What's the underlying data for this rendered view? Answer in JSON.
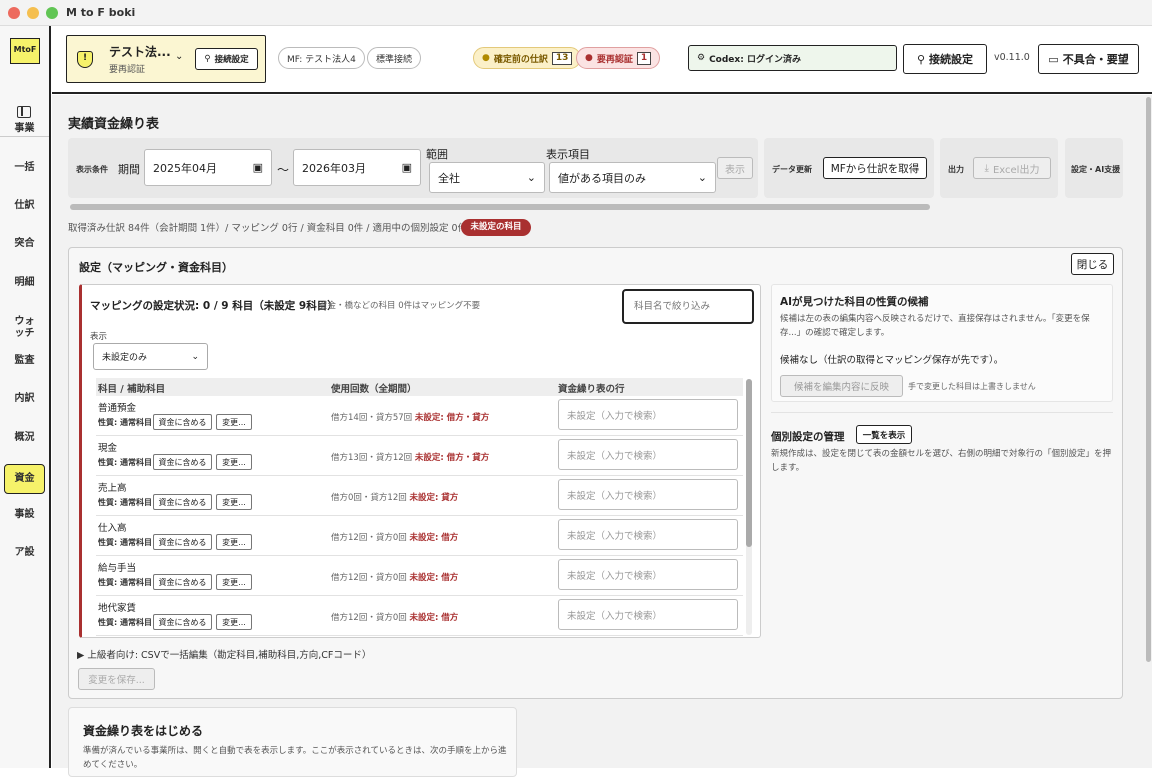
{
  "window": {
    "title": "M to F boki"
  },
  "sidebar": {
    "logo": "MtoF",
    "items": [
      "事業",
      "一括",
      "仕訳",
      "突合",
      "明細",
      "ウォッチ",
      "監査",
      "内訳",
      "概況",
      "資金",
      "事設",
      "ア設"
    ],
    "active": "資金"
  },
  "topbar": {
    "company_name": "テスト法...",
    "company_status": "要再認証",
    "connect_btn": "接続設定",
    "mf_label": "MF: テスト法人4",
    "std_label": "標準接続",
    "pending_label": "確定前の仕訳",
    "pending_count": "13",
    "reauth_label": "要再認証",
    "reauth_count": "1",
    "codex_label": "Codex: ログイン済み",
    "settings_btn": "接続設定",
    "version": "v0.11.0",
    "feedback_btn": "不具合・要望"
  },
  "page": {
    "title": "実績資金繰り表"
  },
  "filters": {
    "cond_label": "表示条件",
    "period_label": "期間",
    "from": "2025年04月",
    "tilde": "〜",
    "to": "2026年03月",
    "scope_label": "範囲",
    "scope": "全社",
    "items_label": "表示項目",
    "items": "値がある項目のみ",
    "show_btn": "表示",
    "data_label": "データ更新",
    "fetch_btn": "MFから仕訳を取得",
    "out_label": "出力",
    "excel_btn": "Excel出力",
    "ai_label": "設定・AI支援"
  },
  "summary": {
    "text": "取得済み仕訳 84件（会計期間 1件）/ マッピング 0行 / 資金科目 0件 / 適用中の個別設定 0件",
    "badge": "未設定の科目"
  },
  "settings": {
    "title": "設定（マッピング・資金科目）",
    "close_btn": "閉じる",
    "map_status": "マッピングの設定状況: 0 / 9 科目（未設定 9科目）",
    "map_note": "資金・橋などの科目 0件はマッピング不要",
    "search_placeholder": "科目名で絞り込み",
    "display_label": "表示",
    "display_value": "未設定のみ",
    "col1": "科目 / 補助科目",
    "col2": "使用回数（全期間）",
    "col3": "資金繰り表の行",
    "rows": [
      {
        "name": "普通預金",
        "prop": "性質: 通常科目",
        "include": "資金に含める",
        "change": "変更...",
        "usage": "借方14回・貸方57回",
        "unset": "未設定: 借方・貸方",
        "placeholder": "未設定（入力で検索）"
      },
      {
        "name": "現金",
        "prop": "性質: 通常科目",
        "include": "資金に含める",
        "change": "変更...",
        "usage": "借方13回・貸方12回",
        "unset": "未設定: 借方・貸方",
        "placeholder": "未設定（入力で検索）"
      },
      {
        "name": "売上高",
        "prop": "性質: 通常科目",
        "include": "資金に含める",
        "change": "変更...",
        "usage": "借方0回・貸方12回",
        "unset": "未設定: 貸方",
        "placeholder": "未設定（入力で検索）"
      },
      {
        "name": "仕入高",
        "prop": "性質: 通常科目",
        "include": "資金に含める",
        "change": "変更...",
        "usage": "借方12回・貸方0回",
        "unset": "未設定: 借方",
        "placeholder": "未設定（入力で検索）"
      },
      {
        "name": "給与手当",
        "prop": "性質: 通常科目",
        "include": "資金に含める",
        "change": "変更...",
        "usage": "借方12回・貸方0回",
        "unset": "未設定: 借方",
        "placeholder": "未設定（入力で検索）"
      },
      {
        "name": "地代家賃",
        "prop": "性質: 通常科目",
        "include": "資金に含める",
        "change": "変更...",
        "usage": "借方12回・貸方0回",
        "unset": "未設定: 借方",
        "placeholder": "未設定（入力で検索）"
      }
    ],
    "ai_title": "AIが見つけた科目の性質の候補",
    "ai_desc": "候補は左の表の編集内容へ反映されるだけで、直接保存はされません。「変更を保存...」の確認で確定します。",
    "ai_none": "候補なし（仕訳の取得とマッピング保存が先です）。",
    "ai_apply_btn": "候補を編集内容に反映",
    "ai_apply_note": "手で変更した科目は上書きしません",
    "indiv_title": "個別設定の管理",
    "indiv_btn": "一覧を表示",
    "indiv_desc": "新規作成は、設定を閉じて表の金額セルを選び、右側の明細で対象行の「個別設定」を押します。",
    "csv_link": "▶ 上級者向け: CSVで一括編集（勘定科目,補助科目,方向,CFコード）",
    "save_btn": "変更を保存..."
  },
  "start": {
    "title": "資金繰り表をはじめる",
    "desc": "準備が済んでいる事業所は、開くと自動で表を表示します。ここが表示されているときは、次の手順を上から進めてください。"
  },
  "colors": {
    "accent": "#f6f26a",
    "danger": "#a93030",
    "pending_bg": "#fbf0c8",
    "reauth_bg": "#fbe3e3",
    "codex_bg": "#eef6ec"
  }
}
